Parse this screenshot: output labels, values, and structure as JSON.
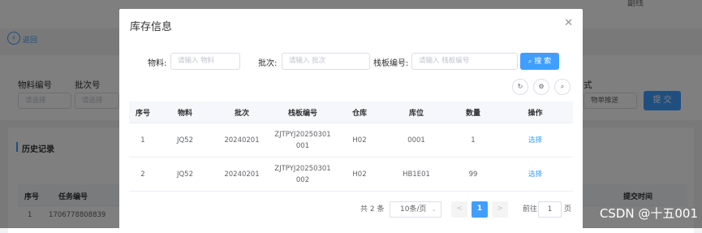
{
  "background": {
    "back_label": "返回",
    "field1_label": "物料编号",
    "field2_label": "批次号",
    "field3_label_partial": "式",
    "select_placeholder": "请选择",
    "right_select_value": "物单推送",
    "submit_label": "提 交",
    "history_title": "历史记录",
    "history_headers": [
      "序号",
      "任务编号"
    ],
    "history_row": [
      "1",
      "1706778808839"
    ],
    "right_header": "提交时间",
    "top_right_text": "副线"
  },
  "modal": {
    "title": "库存信息",
    "close_icon": "close-icon",
    "filters": {
      "material_label": "物料:",
      "material_placeholder": "请输入 物料",
      "batch_label": "批次:",
      "batch_placeholder": "请输入 批次",
      "pallet_label": "栈板编号:",
      "pallet_placeholder": "请输入 栈板编号",
      "search_label": "搜 索"
    },
    "table": {
      "headers": [
        "序号",
        "物料",
        "批次",
        "栈板编号",
        "仓库",
        "库位",
        "数量",
        "操作"
      ],
      "rows": [
        {
          "index": "1",
          "material": "JQ52",
          "batch": "20240201",
          "pallet_line1": "ZJTPYJ20250301",
          "pallet_line2": "001",
          "warehouse": "H02",
          "location": "0001",
          "qty": "1",
          "action": "选择"
        },
        {
          "index": "2",
          "material": "JQ52",
          "batch": "20240201",
          "pallet_line1": "ZJTPYJ20250301",
          "pallet_line2": "002",
          "warehouse": "H02",
          "location": "HB1E01",
          "qty": "99",
          "action": "选择"
        }
      ]
    },
    "pagination": {
      "total": "共 2 条",
      "page_size": "10条/页",
      "prev": "<",
      "current": "1",
      "next": ">",
      "goto_label": "前往",
      "goto_value": "1",
      "page_suffix": "页"
    }
  },
  "watermark": "CSDN @十五001",
  "colors": {
    "primary": "#409eff",
    "overlay": "rgba(0,0,0,0.5)"
  }
}
